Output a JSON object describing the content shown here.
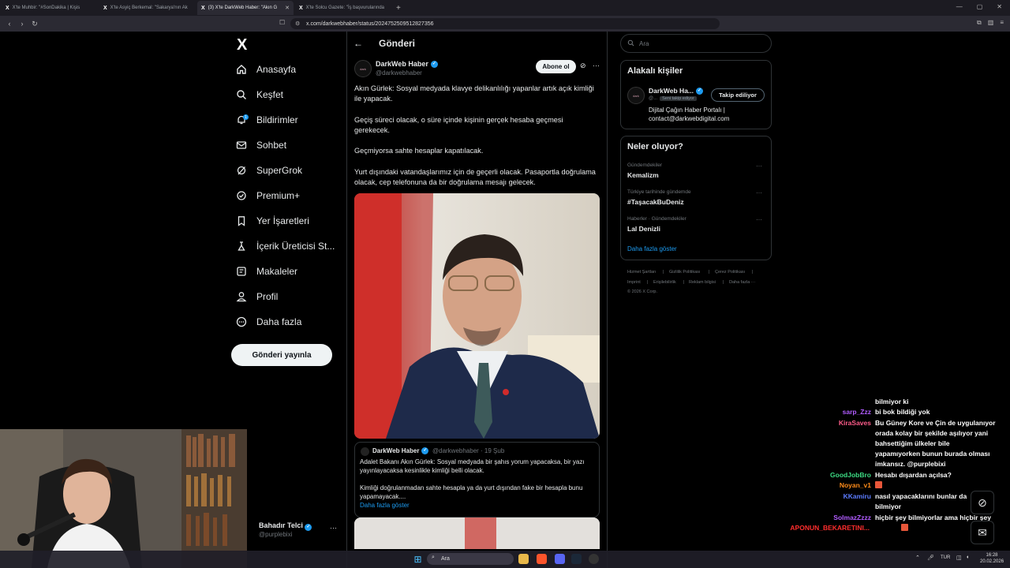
{
  "browser": {
    "tabs": [
      {
        "label": "X'te Muhbir: \"#SonDakika | Kişis"
      },
      {
        "label": "X'te Asyiç Berkemal: \"Sakarya'nın Ak"
      },
      {
        "label": "(3) X'te DarkWeb Haber: \"Akın G"
      },
      {
        "label": "X'te Solcu Gazete: \"İş başvurularında"
      }
    ],
    "url": "x.com/darkwebhaber/status/2024752509512827356"
  },
  "nav": {
    "logo": "X",
    "items": [
      {
        "label": "Anasayfa",
        "icon": "home-icon"
      },
      {
        "label": "Keşfet",
        "icon": "search-icon"
      },
      {
        "label": "Bildirimler",
        "icon": "bell-icon",
        "badge": "1"
      },
      {
        "label": "Sohbet",
        "icon": "mail-icon"
      },
      {
        "label": "SuperGrok",
        "icon": "grok-icon"
      },
      {
        "label": "Premium+",
        "icon": "premium-icon"
      },
      {
        "label": "Yer İşaretleri",
        "icon": "bookmark-icon"
      },
      {
        "label": "İçerik Üreticisi St...",
        "icon": "creator-studio-icon"
      },
      {
        "label": "Makaleler",
        "icon": "articles-icon"
      },
      {
        "label": "Profil",
        "icon": "profile-icon"
      },
      {
        "label": "Daha fazla",
        "icon": "more-circle-icon"
      }
    ],
    "post_button": "Gönderi yayınla"
  },
  "profile": {
    "name": "Bahadır Telci",
    "handle": "@purplebixi"
  },
  "main": {
    "header": "Gönderi",
    "tweet": {
      "name": "DarkWeb Haber",
      "handle": "@darkwebhaber",
      "subscribe": "Abone ol",
      "paragraphs": [
        "Akın Gürlek: Sosyal medyada klavye delikanlılığı yapanlar artık açık kimliği ile yapacak.",
        "Geçiş süreci olacak, o süre içinde kişinin gerçek hesaba geçmesi gerekecek.",
        "Geçmiyorsa sahte hesaplar kapatılacak.",
        "Yurt dışındaki vatandaşlarımız için de geçerli olacak. Pasaportla doğrulama olacak, cep telefonuna da bir doğrulama mesajı gelecek."
      ]
    },
    "quote": {
      "name": "DarkWeb Haber",
      "meta": "@darkwebhaber · 19 Şub",
      "paragraphs": [
        "Adalet Bakanı Akın Gürlek: Sosyal medyada bir şahıs yorum yapacaksa, bir yazı yayınlayacaksa kesinlikle kimliği belli olacak.",
        "Kimliği doğrulanmadan sahte hesapla ya da yurt dışından fake bir hesapla bunu yapamayacak...."
      ],
      "show_more": "Daha fazla göster"
    }
  },
  "right": {
    "search_placeholder": "Ara",
    "related": {
      "title": "Alakalı kişiler",
      "name": "DarkWeb Ha...",
      "handle": "@...",
      "follows_you": "Seni takip ediyor",
      "follow_button": "Takip ediliyor",
      "bio_line1": "Dijital Çağın Haber Portalı |",
      "bio_line2": "contact@darkwebdigital.com"
    },
    "trends": {
      "title": "Neler oluyor?",
      "items": [
        {
          "category": "Gündemdekiler",
          "name": "Kemalizm"
        },
        {
          "category": "Türkiye tarihinde gündemde",
          "name": "#TaşacakBuDeniz"
        },
        {
          "category": "Haberler · Gündemdekiler",
          "name": "Lal Denizli"
        }
      ],
      "show_more": "Daha fazla göster"
    },
    "footer": {
      "line1": [
        "Hizmet Şartları",
        "|",
        "Gizlilik Politikası",
        "|",
        "Çerez Politikası",
        "|"
      ],
      "line2": [
        "Imprint",
        "|",
        "Erişilebilirlik",
        "|",
        "Reklam bilgisi",
        "|",
        "Daha fazla ···"
      ],
      "copyright": "© 2026 X Corp."
    }
  },
  "chat": [
    {
      "user": "",
      "color": "#ffffff",
      "lines": [
        "bilmiyor ki"
      ]
    },
    {
      "user": "sarp_Zzz",
      "color": "#b15cff",
      "lines": [
        "bi bok bildiği yok"
      ]
    },
    {
      "user": "KiraSaves",
      "color": "#ff5c8a",
      "lines": [
        "Bu Güney Kore ve Çin de uygulanıyor",
        "orada kolay bir şekilde aşılıyor yani",
        "bahsettiğim ülkeler bile",
        "yapamıyorken bunun burada olması",
        "imkansız. @purplebixi"
      ]
    },
    {
      "user": "GoodJobBro",
      "color": "#3ddc84",
      "lines": [
        "Hesabı dışardan açılsa?"
      ]
    },
    {
      "user": "Noyan_v1",
      "color": "#ff8c1a",
      "lines": [
        ""
      ]
    },
    {
      "user": "KKamiru",
      "color": "#5c7cff",
      "lines": [
        "nasıl yapacaklarını bunlar da",
        "bilmiyor"
      ]
    },
    {
      "user": "SolmazZzzz",
      "color": "#b15cff",
      "lines": [
        "hiçbir şey bilmiyorlar ama hiçbir şey"
      ]
    },
    {
      "user": "APONUN_BEKARETINI...",
      "color": "#ff2d2d",
      "lines": [
        ""
      ]
    }
  ],
  "taskbar": {
    "search_placeholder": "Ara",
    "lang": "TUR",
    "time": "16:28",
    "date": "20.02.2026"
  }
}
